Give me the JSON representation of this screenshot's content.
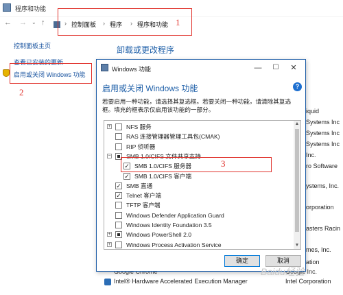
{
  "window": {
    "title": "程序和功能",
    "breadcrumb": [
      "控制面板",
      "程序",
      "程序和功能"
    ]
  },
  "sidebar": {
    "home_link": "控制面板主页",
    "updates_link": "查看已安装的更新",
    "features_link": "启用或关闭 Windows 功能"
  },
  "main": {
    "heading": "卸载或更改程序"
  },
  "background_list": {
    "right_column": [
      "iquid",
      "Systems Inc",
      "Systems Inc",
      "Systems Inc",
      "Inc.",
      "ro Software",
      "ystems, Inc.",
      "orporation",
      "asters Racin",
      "mes, Inc.",
      "ation"
    ],
    "rows": [
      {
        "name": "Google Chrome",
        "publisher": "Google Inc."
      },
      {
        "name": "Intel® Hardware Accelerated Execution Manager",
        "publisher": "Intel Corporation"
      }
    ]
  },
  "dialog": {
    "title": "Windows 功能",
    "heading": "启用或关闭 Windows 功能",
    "help": "?",
    "description": "若要启用一种功能，请选择其复选框。若要关闭一种功能，请清除其复选框。填充的框表示仅启用该功能的一部分。",
    "features": [
      {
        "label": "NFS 服务",
        "state": "unchecked",
        "expander": "+",
        "indent": 0
      },
      {
        "label": "RAS 连接管理器管理工具包(CMAK)",
        "state": "unchecked",
        "expander": "",
        "indent": 0
      },
      {
        "label": "RIP 侦听器",
        "state": "unchecked",
        "expander": "",
        "indent": 0
      },
      {
        "label": "SMB 1.0/CIFS 文件共享支持",
        "state": "partial",
        "expander": "−",
        "indent": 0
      },
      {
        "label": "SMB 1.0/CIFS 服务器",
        "state": "checked",
        "expander": "",
        "indent": 1
      },
      {
        "label": "SMB 1.0/CIFS 客户端",
        "state": "checked",
        "expander": "",
        "indent": 1
      },
      {
        "label": "SMB 直通",
        "state": "checked",
        "expander": "",
        "indent": 0
      },
      {
        "label": "Telnet 客户端",
        "state": "checked",
        "expander": "",
        "indent": 0
      },
      {
        "label": "TFTP 客户端",
        "state": "unchecked",
        "expander": "",
        "indent": 0
      },
      {
        "label": "Windows Defender Application Guard",
        "state": "unchecked",
        "expander": "",
        "indent": 0
      },
      {
        "label": "Windows Identity Foundation 3.5",
        "state": "unchecked",
        "expander": "",
        "indent": 0
      },
      {
        "label": "Windows PowerShell 2.0",
        "state": "partial",
        "expander": "+",
        "indent": 0
      },
      {
        "label": "Windows Process Activation Service",
        "state": "unchecked",
        "expander": "+",
        "indent": 0
      }
    ],
    "ok_label": "确定",
    "cancel_label": "取消"
  },
  "annotations": [
    "1",
    "2",
    "3"
  ],
  "watermark": "Baidu经验",
  "colors": {
    "accent": "#1e5fa8",
    "annotation": "#e0302a",
    "link": "#1a54a0"
  }
}
